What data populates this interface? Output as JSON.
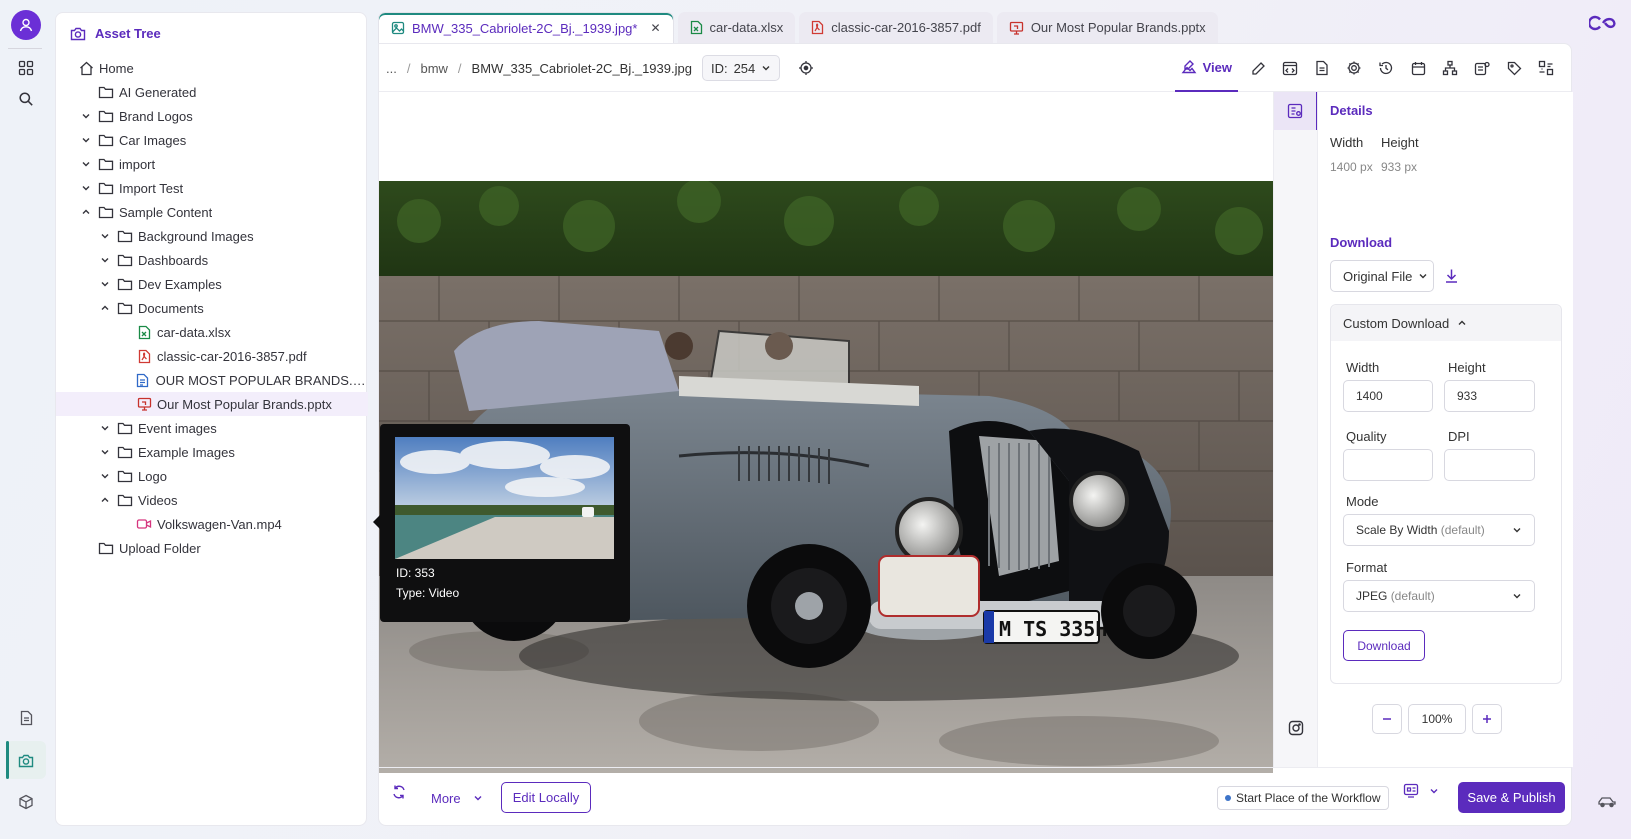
{
  "app": {
    "nav": {
      "items": [
        {
          "icon": "dashboard-icon"
        },
        {
          "icon": "search-icon"
        },
        {
          "icon": "document-icon"
        },
        {
          "icon": "camera-icon"
        },
        {
          "icon": "cube-icon"
        }
      ],
      "active": "camera-icon"
    },
    "colors": {
      "accent": "#5b2bbd",
      "teal": "#1f8a80"
    }
  },
  "tree": {
    "title": "Asset Tree",
    "items": [
      {
        "label": "Home",
        "type": "home",
        "depth": 0,
        "chevron": "none"
      },
      {
        "label": "AI Generated",
        "type": "folder",
        "depth": 1,
        "chevron": "none"
      },
      {
        "label": "Brand Logos",
        "type": "folder",
        "depth": 1,
        "chevron": "down"
      },
      {
        "label": "Car Images",
        "type": "folder",
        "depth": 1,
        "chevron": "down"
      },
      {
        "label": "import",
        "type": "folder",
        "depth": 1,
        "chevron": "down"
      },
      {
        "label": "Import Test",
        "type": "folder",
        "depth": 1,
        "chevron": "down"
      },
      {
        "label": "Sample Content",
        "type": "folder",
        "depth": 1,
        "chevron": "up"
      },
      {
        "label": "Background Images",
        "type": "folder",
        "depth": 2,
        "chevron": "down"
      },
      {
        "label": "Dashboards",
        "type": "folder",
        "depth": 2,
        "chevron": "down"
      },
      {
        "label": "Dev Examples",
        "type": "folder",
        "depth": 2,
        "chevron": "down"
      },
      {
        "label": "Documents",
        "type": "folder",
        "depth": 2,
        "chevron": "up"
      },
      {
        "label": "car-data.xlsx",
        "type": "xlsx",
        "depth": 3,
        "chevron": "none"
      },
      {
        "label": "classic-car-2016-3857.pdf",
        "type": "pdf",
        "depth": 3,
        "chevron": "none"
      },
      {
        "label": "OUR MOST POPULAR BRANDS.do...",
        "type": "doc",
        "depth": 3,
        "chevron": "none"
      },
      {
        "label": "Our Most Popular Brands.pptx",
        "type": "pptx",
        "depth": 3,
        "chevron": "none",
        "selected": true
      },
      {
        "label": "Event images",
        "type": "folder",
        "depth": 2,
        "chevron": "down"
      },
      {
        "label": "Example Images",
        "type": "folder",
        "depth": 2,
        "chevron": "down"
      },
      {
        "label": "Logo",
        "type": "folder",
        "depth": 2,
        "chevron": "down"
      },
      {
        "label": "Videos",
        "type": "folder",
        "depth": 2,
        "chevron": "up"
      },
      {
        "label": "Volkswagen-Van.mp4",
        "type": "video",
        "depth": 3,
        "chevron": "none"
      },
      {
        "label": "Upload Folder",
        "type": "folder",
        "depth": 1,
        "chevron": "none"
      }
    ]
  },
  "tabs": [
    {
      "label": "BMW_335_Cabriolet-2C_Bj._1939.jpg*",
      "type": "image",
      "active": true
    },
    {
      "label": "car-data.xlsx",
      "type": "xlsx"
    },
    {
      "label": "classic-car-2016-3857.pdf",
      "type": "pdf"
    },
    {
      "label": "Our Most Popular Brands.pptx",
      "type": "pptx"
    }
  ],
  "toolbar": {
    "breadcrumb": [
      "...",
      "bmw",
      "BMW_335_Cabriolet-2C_Bj._1939.jpg"
    ],
    "id_label": "ID:",
    "id_value": "254",
    "view_label": "View"
  },
  "details": {
    "title": "Details",
    "width_label": "Width",
    "height_label": "Height",
    "width_value": "1400 px",
    "height_value": "933 px",
    "download_title": "Download",
    "download_option": "Original File",
    "custom_title": "Custom Download",
    "cd_width_label": "Width",
    "cd_height_label": "Height",
    "cd_width_value": "1400",
    "cd_height_value": "933",
    "quality_label": "Quality",
    "dpi_label": "DPI",
    "quality_value": "",
    "dpi_value": "",
    "mode_label": "Mode",
    "mode_value": "Scale By Width",
    "mode_suffix": "(default)",
    "format_label": "Format",
    "format_value": "JPEG",
    "format_suffix": "(default)",
    "download_button": "Download",
    "zoom": "100%"
  },
  "tooltip": {
    "id_text": "ID: 353",
    "type_text": "Type: Video"
  },
  "bottom": {
    "more_label": "More",
    "edit_label": "Edit Locally",
    "workflow_label": "Start Place of the Workflow",
    "save_label": "Save & Publish"
  }
}
